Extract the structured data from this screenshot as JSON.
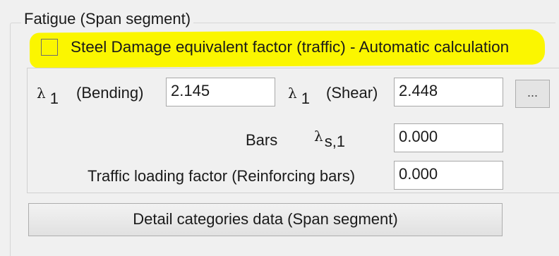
{
  "group": {
    "title": "Fatigue  (Span segment)"
  },
  "checkbox": {
    "label": "Steel Damage equivalent factor (traffic) - Automatic calculation",
    "checked": false,
    "highlight_color": "#fbf600"
  },
  "row1": {
    "lambda_symbol": "λ",
    "bending_sub": "1",
    "bending_label": "(Bending)",
    "bending_value": "2.145",
    "shear_sub": "1",
    "shear_label": "(Shear)",
    "shear_value": "2.448",
    "more_button_label": "..."
  },
  "row2": {
    "bars_label": "Bars",
    "lambda_symbol": "λ",
    "lambda_sub": "s,1",
    "value": "0.000"
  },
  "row3": {
    "label": "Traffic loading factor (Reinforcing bars)",
    "value": "0.000"
  },
  "detail_button": {
    "label": "Detail categories data  (Span segment)"
  }
}
